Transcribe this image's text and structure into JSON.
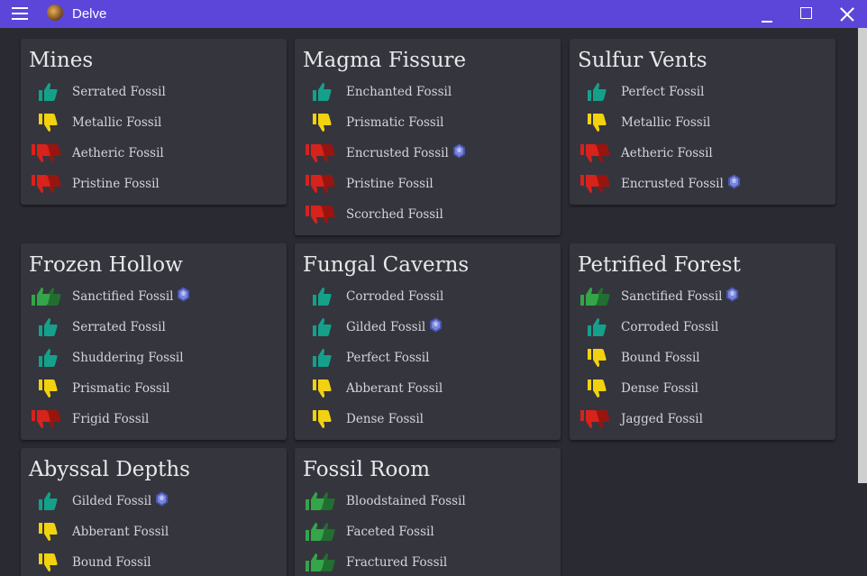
{
  "window": {
    "title": "Delve"
  },
  "colors": {
    "titlebar": "#5b46d9",
    "background": "#2a2a32",
    "card": "#35353e",
    "like": "#15a08a",
    "doublelike": "#34a548",
    "dislike": "#f2d20f",
    "doubledislike": "#d8221c"
  },
  "cards": [
    {
      "title": "Mines",
      "fossils": [
        {
          "name": "Serrated Fossil",
          "rating": "like",
          "gem": false
        },
        {
          "name": "Metallic Fossil",
          "rating": "dislike",
          "gem": false
        },
        {
          "name": "Aetheric Fossil",
          "rating": "doubledislike",
          "gem": false
        },
        {
          "name": "Pristine Fossil",
          "rating": "doubledislike",
          "gem": false
        }
      ]
    },
    {
      "title": "Magma Fissure",
      "fossils": [
        {
          "name": "Enchanted Fossil",
          "rating": "like",
          "gem": false
        },
        {
          "name": "Prismatic Fossil",
          "rating": "dislike",
          "gem": false
        },
        {
          "name": "Encrusted Fossil",
          "rating": "doubledislike",
          "gem": true
        },
        {
          "name": "Pristine Fossil",
          "rating": "doubledislike",
          "gem": false
        },
        {
          "name": "Scorched Fossil",
          "rating": "doubledislike",
          "gem": false
        }
      ]
    },
    {
      "title": "Sulfur Vents",
      "fossils": [
        {
          "name": "Perfect Fossil",
          "rating": "like",
          "gem": false
        },
        {
          "name": "Metallic Fossil",
          "rating": "dislike",
          "gem": false
        },
        {
          "name": "Aetheric Fossil",
          "rating": "doubledislike",
          "gem": false
        },
        {
          "name": "Encrusted Fossil",
          "rating": "doubledislike",
          "gem": true
        }
      ]
    },
    {
      "title": "Frozen Hollow",
      "fossils": [
        {
          "name": "Sanctified Fossil",
          "rating": "doublelike",
          "gem": true
        },
        {
          "name": "Serrated Fossil",
          "rating": "like",
          "gem": false
        },
        {
          "name": "Shuddering Fossil",
          "rating": "like",
          "gem": false
        },
        {
          "name": "Prismatic Fossil",
          "rating": "dislike",
          "gem": false
        },
        {
          "name": "Frigid Fossil",
          "rating": "doubledislike",
          "gem": false
        }
      ]
    },
    {
      "title": "Fungal Caverns",
      "fossils": [
        {
          "name": "Corroded Fossil",
          "rating": "like",
          "gem": false
        },
        {
          "name": "Gilded Fossil",
          "rating": "like",
          "gem": true
        },
        {
          "name": "Perfect Fossil",
          "rating": "like",
          "gem": false
        },
        {
          "name": "Abberant Fossil",
          "rating": "dislike",
          "gem": false
        },
        {
          "name": "Dense Fossil",
          "rating": "dislike",
          "gem": false
        }
      ]
    },
    {
      "title": "Petrified Forest",
      "fossils": [
        {
          "name": "Sanctified Fossil",
          "rating": "doublelike",
          "gem": true
        },
        {
          "name": "Corroded Fossil",
          "rating": "like",
          "gem": false
        },
        {
          "name": "Bound Fossil",
          "rating": "dislike",
          "gem": false
        },
        {
          "name": "Dense Fossil",
          "rating": "dislike",
          "gem": false
        },
        {
          "name": "Jagged Fossil",
          "rating": "doubledislike",
          "gem": false
        }
      ]
    },
    {
      "title": "Abyssal Depths",
      "fossils": [
        {
          "name": "Gilded Fossil",
          "rating": "like",
          "gem": true
        },
        {
          "name": "Abberant Fossil",
          "rating": "dislike",
          "gem": false
        },
        {
          "name": "Bound Fossil",
          "rating": "dislike",
          "gem": false
        }
      ]
    },
    {
      "title": "Fossil Room",
      "fossils": [
        {
          "name": "Bloodstained Fossil",
          "rating": "doublelike",
          "gem": false
        },
        {
          "name": "Faceted Fossil",
          "rating": "doublelike",
          "gem": false
        },
        {
          "name": "Fractured Fossil",
          "rating": "doublelike",
          "gem": false
        }
      ]
    }
  ]
}
